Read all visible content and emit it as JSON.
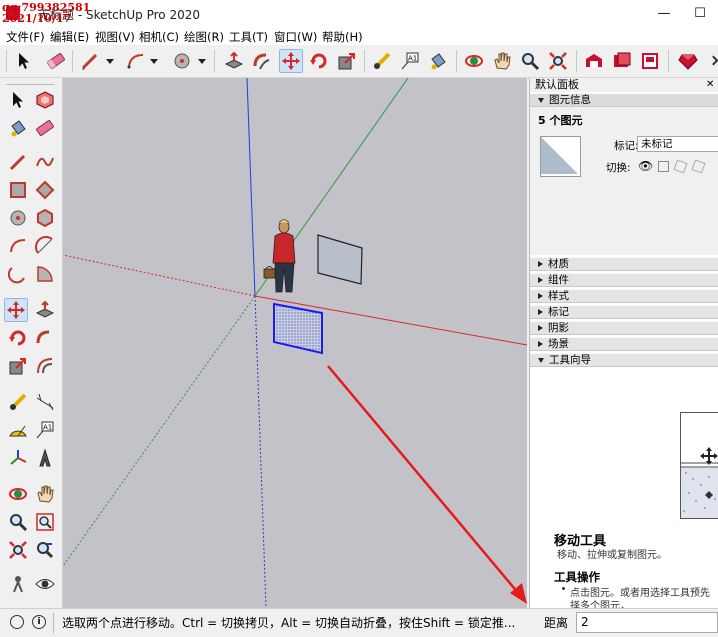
{
  "window": {
    "title": "无标题 - SketchUp Pro 2020",
    "watermark_line1": "qq:799382581",
    "watermark_line2": "2021/10/17",
    "minimize": "—",
    "maximize": "☐",
    "close": "✕"
  },
  "menu": [
    {
      "label": "文件(F)"
    },
    {
      "label": "编辑(E)"
    },
    {
      "label": "视图(V)"
    },
    {
      "label": "相机(C)"
    },
    {
      "label": "绘图(R)"
    },
    {
      "label": "工具(T)"
    },
    {
      "label": "窗口(W)"
    },
    {
      "label": "帮助(H)"
    }
  ],
  "toolbar": {
    "active_tool": "move-tool",
    "icons": [
      "select-arrow-icon",
      "eraser-icon",
      "pencil-line-icon",
      "arc-icon",
      "circle-icon",
      "push-pull-icon",
      "follow-me-icon",
      "move-icon",
      "rotate-icon",
      "scale-icon",
      "tape-measure-icon",
      "text-icon",
      "paint-bucket-icon",
      "orbit-icon",
      "pan-icon",
      "zoom-icon",
      "zoom-extents-icon",
      "warehouse-icon",
      "extension-warehouse-icon",
      "layout-icon",
      "ruby-icon"
    ]
  },
  "tray": {
    "title": "默认面板",
    "entity_info": {
      "header": "图元信息",
      "count_label": "5 个图元",
      "tag_label": "标记:",
      "tag_value": "未标记",
      "toggle_label": "切换:"
    },
    "sections": [
      {
        "label": "材质"
      },
      {
        "label": "组件"
      },
      {
        "label": "样式"
      },
      {
        "label": "标记"
      },
      {
        "label": "阴影"
      },
      {
        "label": "场景"
      }
    ],
    "instructor": {
      "header": "工具向导",
      "tool_title": "移动工具",
      "tool_desc": "移动、拉伸或复制图元。",
      "ops_title": "工具操作",
      "ops_line1": "点击图元。或者用选择工具预先",
      "ops_line2": "择多个图元，"
    }
  },
  "status": {
    "message": "选取两个点进行移动。Ctrl = 切换拷贝，Alt = 切换自动折叠，按住Shift = 锁定推...",
    "measure_label": "距离",
    "measure_value": "2"
  },
  "colors": {
    "accent_selection": "#1c1cf0",
    "annotation_arrow": "#e51b1b",
    "sketchup_red": "#c8102e"
  }
}
